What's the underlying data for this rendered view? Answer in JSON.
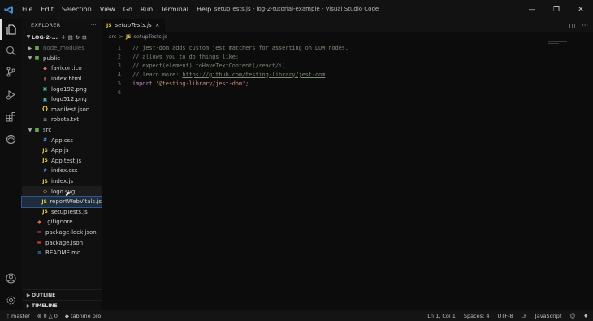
{
  "titlebar": {
    "menu": [
      "File",
      "Edit",
      "Selection",
      "View",
      "Go",
      "Run",
      "Terminal",
      "Help"
    ],
    "title": "setupTests.js - log-2-tutorial-example - Visual Studio Code"
  },
  "sidebar": {
    "header": "EXPLORER",
    "header_more": "···",
    "folder": "LOG-2-...",
    "items": [
      {
        "label": "node_modules",
        "icon": "folder-node-icon",
        "kind": "folder-collapsed"
      },
      {
        "label": "public",
        "icon": "folder-public-icon",
        "kind": "folder-open"
      },
      {
        "label": "favicon.ico",
        "icon": "image-file-icon",
        "kind": "file"
      },
      {
        "label": "index.html",
        "icon": "html-file-icon",
        "kind": "file"
      },
      {
        "label": "logo192.png",
        "icon": "png-file-icon",
        "kind": "file"
      },
      {
        "label": "logo512.png",
        "icon": "png-file-icon",
        "kind": "file"
      },
      {
        "label": "manifest.json",
        "icon": "json-file-icon",
        "kind": "file"
      },
      {
        "label": "robots.txt",
        "icon": "text-file-icon",
        "kind": "file"
      },
      {
        "label": "src",
        "icon": "folder-src-icon",
        "kind": "folder-open"
      },
      {
        "label": "App.css",
        "icon": "css-file-icon",
        "kind": "file"
      },
      {
        "label": "App.js",
        "icon": "js-file-icon",
        "kind": "file"
      },
      {
        "label": "App.test.js",
        "icon": "test-file-icon",
        "kind": "file"
      },
      {
        "label": "index.css",
        "icon": "css-file-icon",
        "kind": "file"
      },
      {
        "label": "index.js",
        "icon": "js-file-icon",
        "kind": "file"
      },
      {
        "label": "logo.svg",
        "icon": "svg-file-icon",
        "kind": "file"
      },
      {
        "label": "reportWebVitals.js",
        "icon": "js-file-icon",
        "kind": "file"
      },
      {
        "label": "setupTests.js",
        "icon": "js-file-icon",
        "kind": "file"
      },
      {
        "label": ".gitignore",
        "icon": "git-file-icon",
        "kind": "file"
      },
      {
        "label": "package-lock.json",
        "icon": "npm-file-icon",
        "kind": "file"
      },
      {
        "label": "package.json",
        "icon": "npm-file-icon",
        "kind": "file"
      },
      {
        "label": "README.md",
        "icon": "markdown-file-icon",
        "kind": "file"
      }
    ],
    "outline": "OUTLINE",
    "timeline": "TIMELINE"
  },
  "editor": {
    "tab_label": "setupTests.js",
    "tab_lang": "JS",
    "tab_close": "×",
    "breadcrumb": [
      "src",
      ">",
      "JS",
      "setupTests.js"
    ],
    "lines": [
      {
        "n": "1",
        "text": "// jest-dom adds custom jest matchers for asserting on DOM nodes."
      },
      {
        "n": "2",
        "text": "// allows you to do things like:"
      },
      {
        "n": "3",
        "text": "// expect(element).toHaveTextContent(/react/i)"
      },
      {
        "n": "4",
        "pre": "// learn more: ",
        "link": "https://github.com/testing-library/jest-dom"
      },
      {
        "n": "5",
        "kw": "import",
        "str": "'@testing-library/jest-dom'",
        "end": ";"
      },
      {
        "n": "6",
        "text": ""
      }
    ]
  },
  "statusbar": {
    "branch": "master",
    "errors": "0",
    "warnings": "0",
    "tabnine": "tabnine pro",
    "position": "Ln 1, Col 1",
    "spaces": "Spaces: 4",
    "encoding": "UTF-8",
    "eol": "LF",
    "language": "JavaScript"
  },
  "colors": {
    "accent": "#2d5a8a",
    "comment": "#7a8a72",
    "keyword": "#c586c0",
    "string": "#ce9178",
    "js_badge": "#e6c84a"
  }
}
